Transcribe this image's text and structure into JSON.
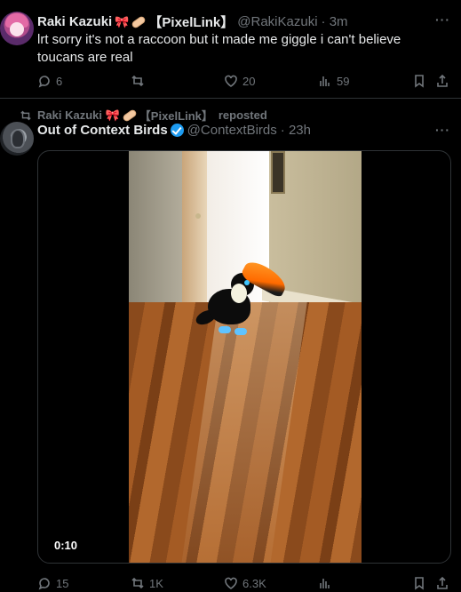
{
  "tweet1": {
    "author_name": "Raki Kazuki",
    "emoji_ribbon": "🎀",
    "tag": "【PixelLink】",
    "handle": "@RakiKazuki",
    "time": "· 3m",
    "text": "lrt sorry it's not a raccoon but it made me giggle i can't believe toucans are real",
    "replies": "6",
    "likes": "20",
    "views": "59"
  },
  "repost_line": {
    "text": "Raki Kazuki 🎀",
    "tag": "【PixelLink】",
    "suffix": "reposted"
  },
  "tweet2": {
    "author_name": "Out of Context Birds",
    "handle": "@ContextBirds",
    "time": "· 23h",
    "video_time": "0:10",
    "replies": "15",
    "reposts": "1K",
    "likes": "6.3K"
  },
  "colors": {
    "background": "#000000",
    "muted": "#71767b",
    "text": "#e7e9ea",
    "verified": "#1d9bf0"
  }
}
